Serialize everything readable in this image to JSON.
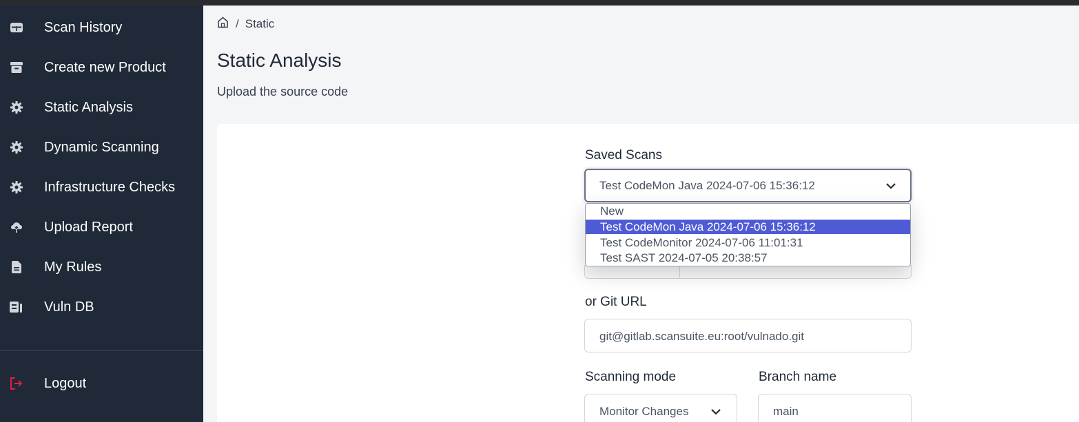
{
  "sidebar": {
    "items": [
      {
        "label": "Scan History",
        "icon": "table-icon"
      },
      {
        "label": "Create new Product",
        "icon": "archive-icon"
      },
      {
        "label": "Static Analysis",
        "icon": "gear-icon"
      },
      {
        "label": "Dynamic Scanning",
        "icon": "gear-icon"
      },
      {
        "label": "Infrastructure Checks",
        "icon": "gear-icon"
      },
      {
        "label": "Upload Report",
        "icon": "cloud-upload-icon"
      },
      {
        "label": "My Rules",
        "icon": "document-icon"
      },
      {
        "label": "Vuln DB",
        "icon": "database-icon"
      }
    ],
    "logout": {
      "label": "Logout",
      "icon": "logout-icon"
    }
  },
  "breadcrumb": {
    "separator": "/",
    "current": "Static"
  },
  "page": {
    "title": "Static Analysis",
    "subtitle": "Upload the source code"
  },
  "form": {
    "saved_scans": {
      "label": "Saved Scans",
      "value": "Test CodeMon Java 2024-07-06 15:36:12",
      "options": [
        "New",
        "Test CodeMon Java 2024-07-06 15:36:12",
        "Test CodeMonitor 2024-07-06 11:01:31",
        "Test SAST 2024-07-05 20:38:57"
      ],
      "selected_index": 1
    },
    "git_url": {
      "label": "or Git URL",
      "value": "git@gitlab.scansuite.eu:root/vulnado.git"
    },
    "scanning_mode": {
      "label": "Scanning mode",
      "value": "Monitor Changes"
    },
    "branch_name": {
      "label": "Branch name",
      "value": "main"
    }
  },
  "colors": {
    "sidebar_bg": "#1f2937",
    "accent_selected": "#4f5bd5",
    "logout_icon": "#e11d48"
  }
}
